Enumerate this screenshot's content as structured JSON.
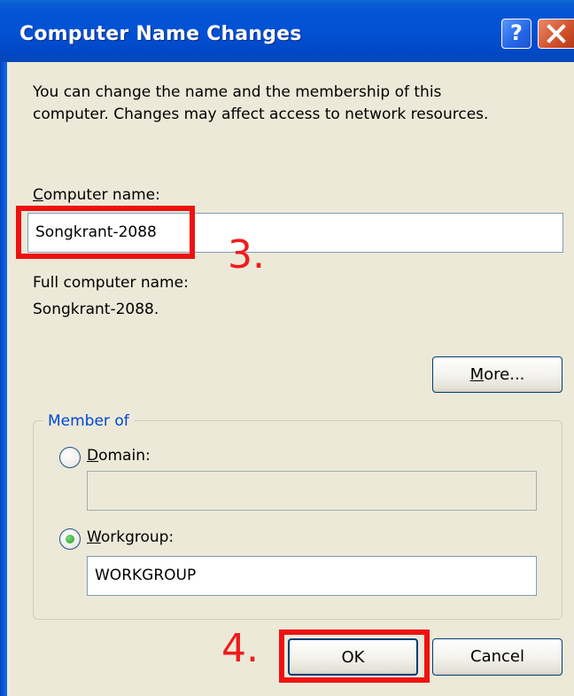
{
  "window": {
    "title": "Computer Name Changes",
    "help_button": "?",
    "close_button": "close"
  },
  "intro": {
    "line1": "You can change the name and the membership of this",
    "line2": "computer. Changes may affect access to network resources."
  },
  "computer_name": {
    "label": "Computer name:",
    "value": "Songkrant-2088"
  },
  "full_name": {
    "label": "Full computer name:",
    "value": "Songkrant-2088."
  },
  "more_button": "More...",
  "member_of": {
    "legend": "Member of",
    "domain_label": "Domain:",
    "domain_value": "",
    "workgroup_label": "Workgroup:",
    "workgroup_value": "WORKGROUP",
    "selected": "workgroup"
  },
  "buttons": {
    "ok": "OK",
    "cancel": "Cancel"
  },
  "annotations": {
    "step3": "3.",
    "step4": "4."
  },
  "colors": {
    "titlebar": "#0251d4",
    "dialog_background": "#ece9d8",
    "group_label": "#0046d5",
    "annotation": "#ee1c1c"
  }
}
